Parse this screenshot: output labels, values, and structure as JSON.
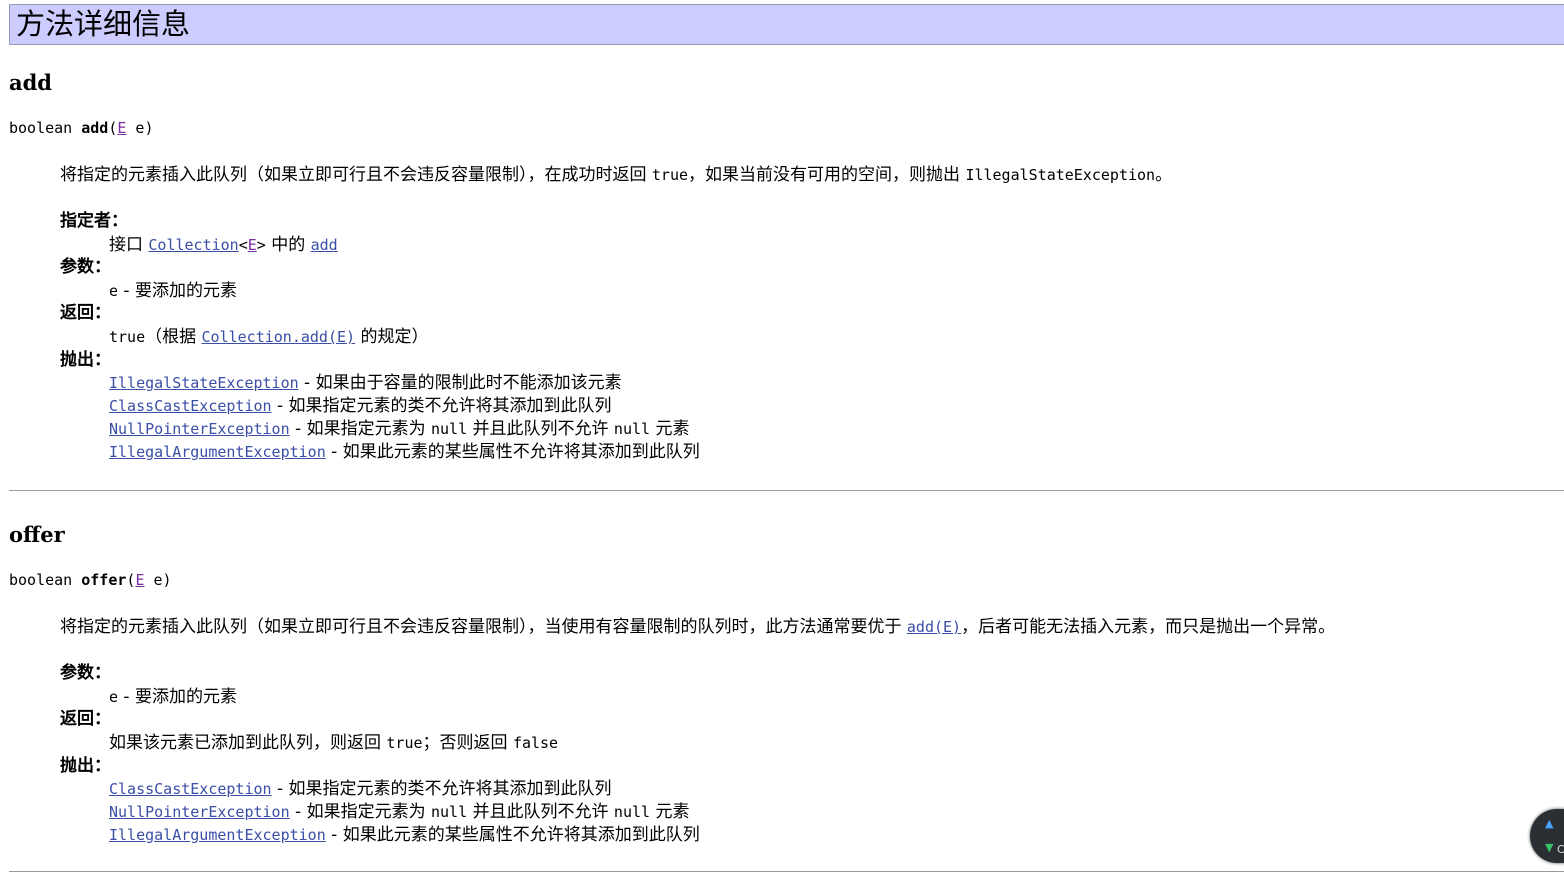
{
  "header": {
    "title": "方法详细信息"
  },
  "add": {
    "name": "add",
    "sig_type": "boolean ",
    "sig_name": "add",
    "sig_open": "(",
    "sig_param_type": "E",
    "sig_close": " e)",
    "desc_a": "将指定的元素插入此队列（如果立即可行且不会违反容量限制），在成功时返回 ",
    "desc_true": "true",
    "desc_b": "，如果当前没有可用的空间，则抛出 ",
    "desc_exc": "IllegalStateException",
    "desc_c": "。",
    "specified_label": "指定者：",
    "specified_prefix": "接口 ",
    "specified_iface": "Collection",
    "specified_lt": "<",
    "specified_param": "E",
    "specified_gt": ">",
    "specified_mid": " 中的 ",
    "specified_method": "add",
    "params_label": "参数：",
    "param_name": "e",
    "param_desc": " - 要添加的元素",
    "returns_label": "返回：",
    "returns_true": "true",
    "returns_a": "（根据 ",
    "returns_link": "Collection.add(E)",
    "returns_b": " 的规定）",
    "throws_label": "抛出：",
    "throws": [
      {
        "exc": "IllegalStateException",
        "desc": " - 如果由于容量的限制此时不能添加该元素"
      },
      {
        "exc": "ClassCastException",
        "desc": " - 如果指定元素的类不允许将其添加到此队列"
      },
      {
        "exc": "NullPointerException",
        "desc_a": " - 如果指定元素为 ",
        "null1": "null",
        "desc_b": " 并且此队列不允许 ",
        "null2": "null",
        "desc_c": " 元素"
      },
      {
        "exc": "IllegalArgumentException",
        "desc": " - 如果此元素的某些属性不允许将其添加到此队列"
      }
    ]
  },
  "offer": {
    "name": "offer",
    "sig_type": "boolean ",
    "sig_name": "offer",
    "sig_open": "(",
    "sig_param_type": "E",
    "sig_close": " e)",
    "desc_a": "将指定的元素插入此队列（如果立即可行且不会违反容量限制），当使用有容量限制的队列时，此方法通常要优于 ",
    "desc_link": "add(E)",
    "desc_b": "，后者可能无法插入元素，而只是抛出一个异常。",
    "params_label": "参数：",
    "param_name": "e",
    "param_desc": " - 要添加的元素",
    "returns_label": "返回：",
    "returns_a": "如果该元素已添加到此队列，则返回 ",
    "returns_true": "true",
    "returns_b": "；否则返回 ",
    "returns_false": "false",
    "throws_label": "抛出：",
    "throws": [
      {
        "exc": "ClassCastException",
        "desc": " - 如果指定元素的类不允许将其添加到此队列"
      },
      {
        "exc": "NullPointerException",
        "desc_a": " - 如果指定元素为 ",
        "null1": "null",
        "desc_b": " 并且此队列不允许 ",
        "null2": "null",
        "desc_c": " 元素"
      },
      {
        "exc": "IllegalArgumentException",
        "desc": " - 如果此元素的某些属性不允许将其添加到此队列"
      }
    ]
  },
  "scroll_widget": {
    "up_icon": "▲",
    "down_icon": "▼",
    "label": "C"
  }
}
